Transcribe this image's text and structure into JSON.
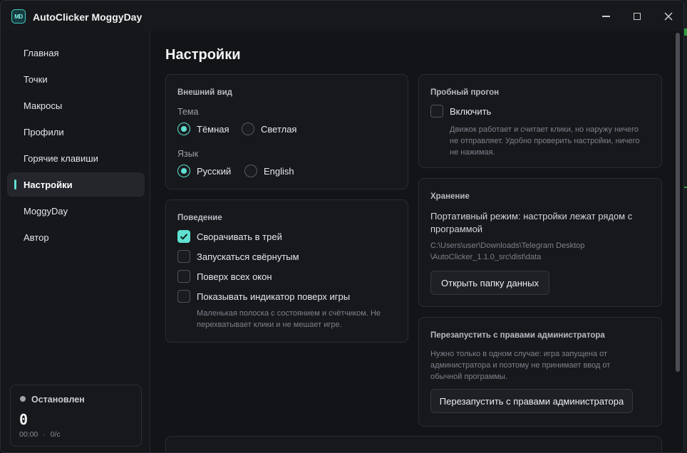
{
  "window": {
    "logo_text": "MD",
    "title": "AutoClicker MoggyDay",
    "controls": {
      "minimize": "minimize-icon",
      "maximize": "maximize-icon",
      "close": "close-icon"
    }
  },
  "sidebar": {
    "items": [
      {
        "label": "Главная"
      },
      {
        "label": "Точки"
      },
      {
        "label": "Макросы"
      },
      {
        "label": "Профили"
      },
      {
        "label": "Горячие клавиши"
      },
      {
        "label": "Настройки",
        "active": true
      },
      {
        "label": "MoggyDay"
      },
      {
        "label": "Автор"
      }
    ],
    "status": {
      "state": "Остановлен",
      "count": "0",
      "time": "00:00",
      "separator": "·",
      "rate": "0/с"
    }
  },
  "page": {
    "title": "Настройки",
    "appearance": {
      "heading": "Внешний вид",
      "theme_label": "Тема",
      "theme_options": [
        "Тёмная",
        "Светлая"
      ],
      "theme_selected": "Тёмная",
      "language_label": "Язык",
      "language_options": [
        "Русский",
        "English"
      ],
      "language_selected": "Русский"
    },
    "behavior": {
      "heading": "Поведение",
      "options": [
        {
          "label": "Сворачивать в трей",
          "checked": true
        },
        {
          "label": "Запускаться свёрнутым",
          "checked": false
        },
        {
          "label": "Поверх всех окон",
          "checked": false
        },
        {
          "label": "Показывать индикатор поверх игры",
          "checked": false
        }
      ],
      "hint_line1": "Маленькая полоска с состоянием и счётчиком. Не",
      "hint_line2": "перехватывает клики и не мешает игре."
    },
    "dry_run": {
      "heading": "Пробный прогон",
      "enable_label": "Включить",
      "enabled": false,
      "hint_line1": "Движок работает и считает клики, но наружу ничего",
      "hint_line2": "не отправляет. Удобно проверить настройки, ничего",
      "hint_line3": "не нажимая."
    },
    "storage": {
      "heading": "Хранение",
      "mode_line1": "Портативный режим: настройки лежат рядом с",
      "mode_line2": "программой",
      "path_line1": "C:\\Users\\user\\Downloads\\Telegram Desktop",
      "path_line2": "\\AutoClicker_1.1.0_src\\dist\\data",
      "open_button": "Открыть папку данных"
    },
    "admin": {
      "heading": "Перезапустить с правами администратора",
      "desc_line1": "Нужно только в одном случае: игра запущена от",
      "desc_line2": "администратора и поэтому не принимает ввод от",
      "desc_line3": "обычной программы.",
      "button": "Перезапустить с правами администратора"
    }
  },
  "colors": {
    "accent": "#5fe0d0",
    "background": "#131417",
    "card": "#17181c",
    "border": "#2a2c31"
  }
}
